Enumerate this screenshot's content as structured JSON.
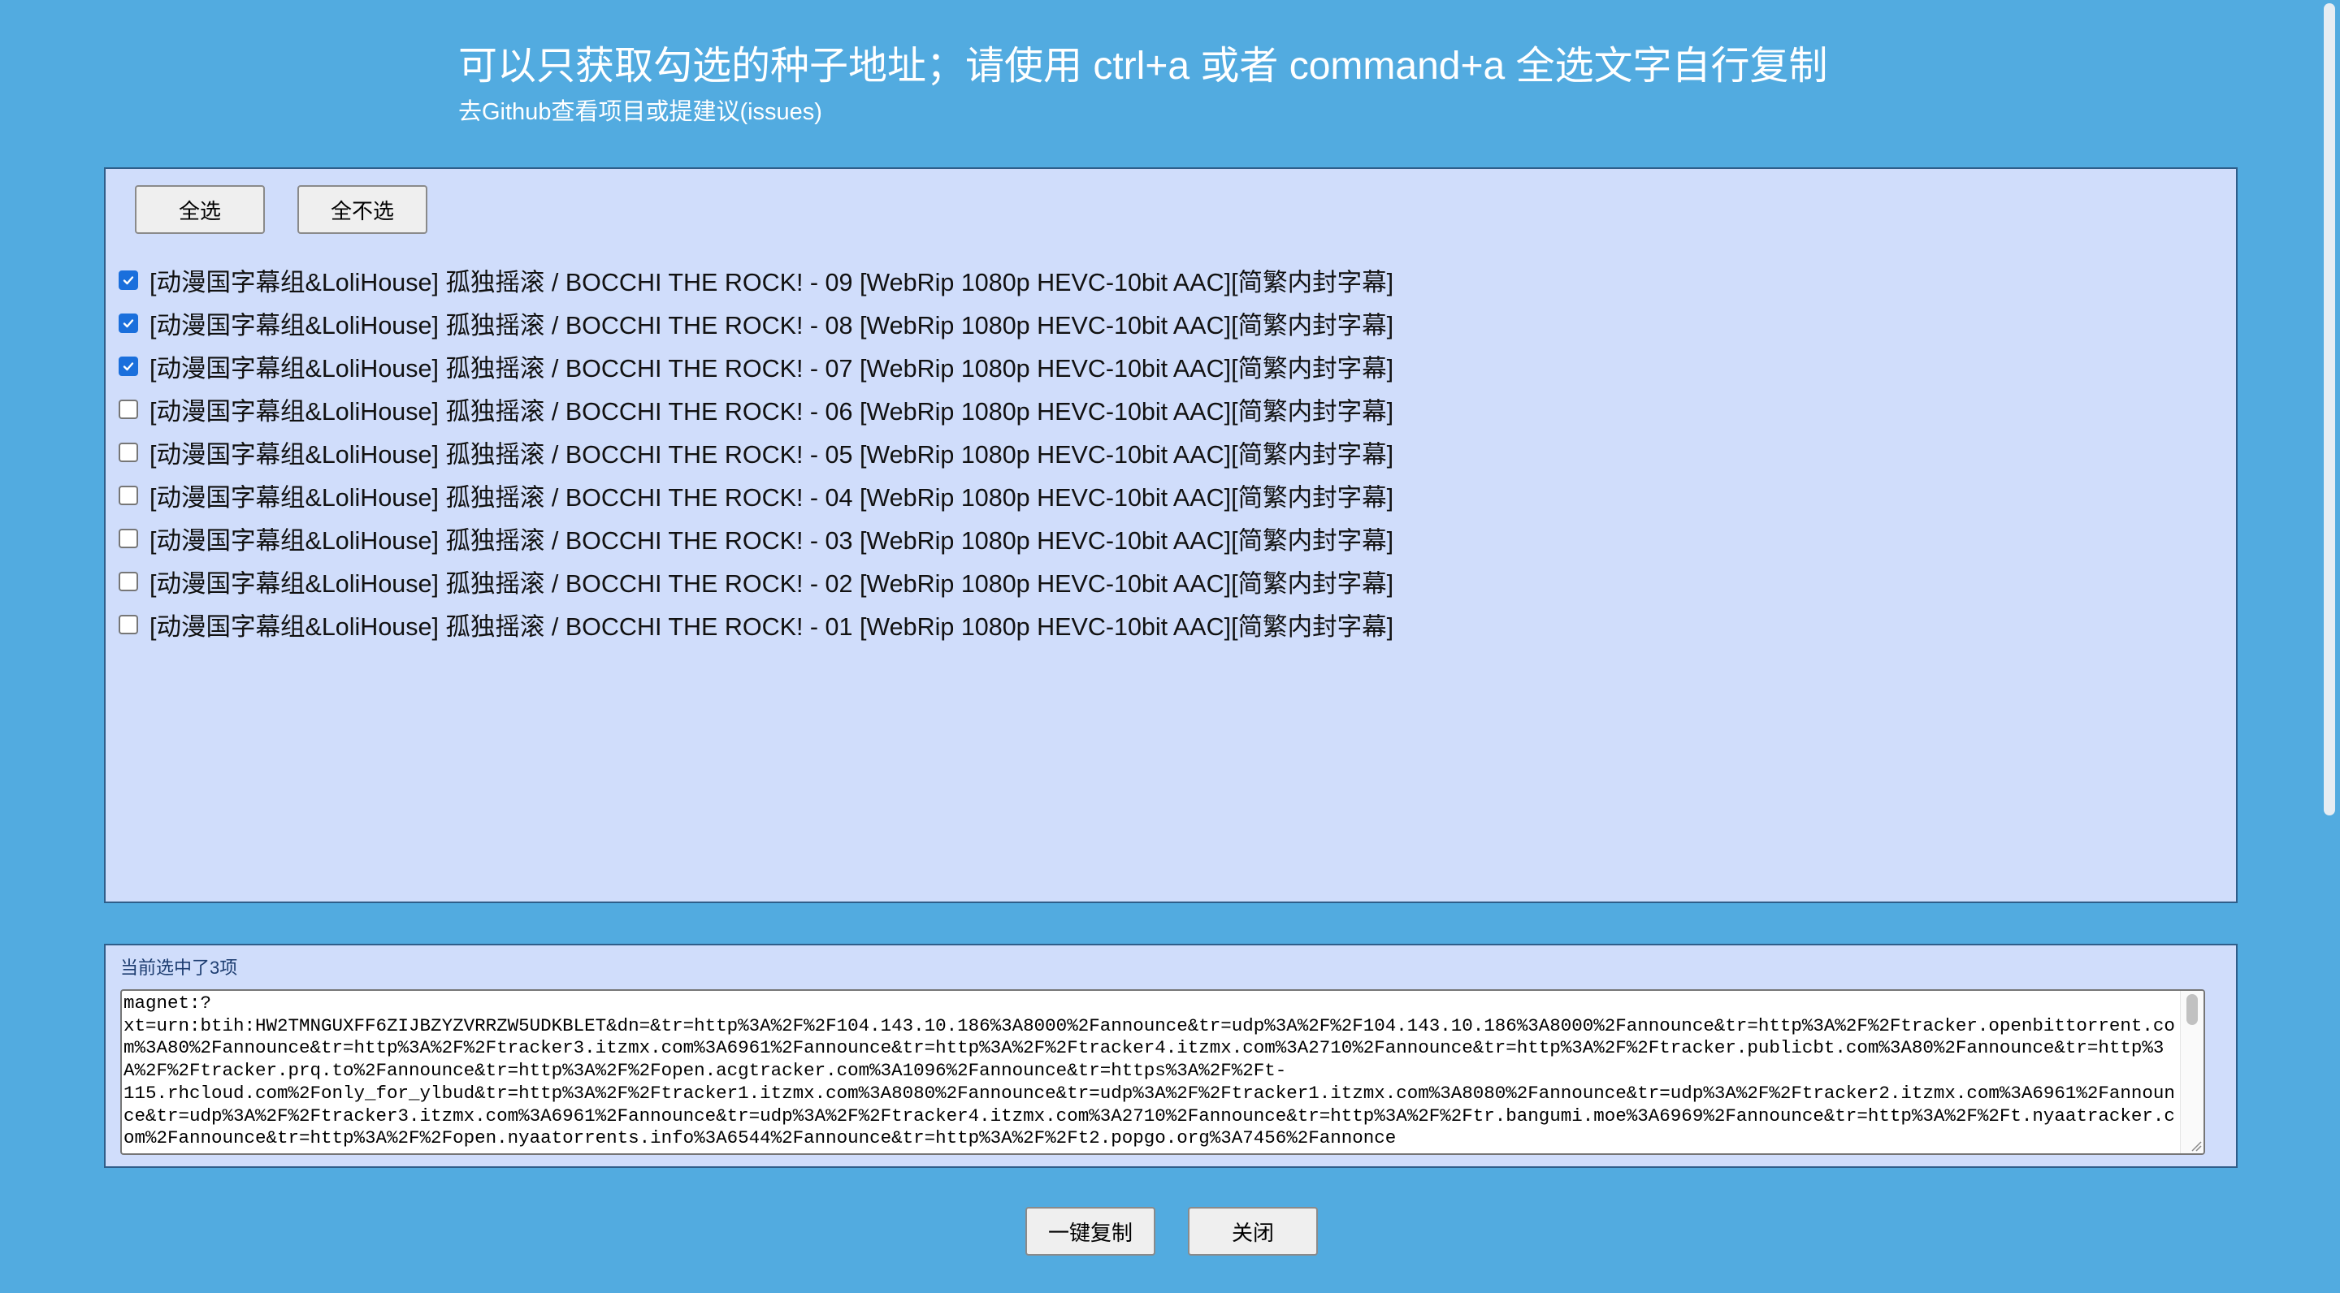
{
  "header": {
    "title": "可以只获取勾选的种子地址；请使用 ctrl+a 或者 command+a 全选文字自行复制",
    "subtitle_link": "去Github查看项目或提建议(issues)"
  },
  "toolbar": {
    "select_all_label": "全选",
    "select_none_label": "全不选"
  },
  "torrents": [
    {
      "label": "[动漫国字幕组&LoliHouse] 孤独摇滚 / BOCCHI THE ROCK! - 09 [WebRip 1080p HEVC-10bit AAC][简繁内封字幕]",
      "checked": true
    },
    {
      "label": "[动漫国字幕组&LoliHouse] 孤独摇滚 / BOCCHI THE ROCK! - 08 [WebRip 1080p HEVC-10bit AAC][简繁内封字幕]",
      "checked": true
    },
    {
      "label": "[动漫国字幕组&LoliHouse] 孤独摇滚 / BOCCHI THE ROCK! - 07 [WebRip 1080p HEVC-10bit AAC][简繁内封字幕]",
      "checked": true
    },
    {
      "label": "[动漫国字幕组&LoliHouse] 孤独摇滚 / BOCCHI THE ROCK! - 06 [WebRip 1080p HEVC-10bit AAC][简繁内封字幕]",
      "checked": false
    },
    {
      "label": "[动漫国字幕组&LoliHouse] 孤独摇滚 / BOCCHI THE ROCK! - 05 [WebRip 1080p HEVC-10bit AAC][简繁内封字幕]",
      "checked": false
    },
    {
      "label": "[动漫国字幕组&LoliHouse] 孤独摇滚 / BOCCHI THE ROCK! - 04 [WebRip 1080p HEVC-10bit AAC][简繁内封字幕]",
      "checked": false
    },
    {
      "label": "[动漫国字幕组&LoliHouse] 孤独摇滚 / BOCCHI THE ROCK! - 03 [WebRip 1080p HEVC-10bit AAC][简繁内封字幕]",
      "checked": false
    },
    {
      "label": "[动漫国字幕组&LoliHouse] 孤独摇滚 / BOCCHI THE ROCK! - 02 [WebRip 1080p HEVC-10bit AAC][简繁内封字幕]",
      "checked": false
    },
    {
      "label": "[动漫国字幕组&LoliHouse] 孤独摇滚 / BOCCHI THE ROCK! - 01 [WebRip 1080p HEVC-10bit AAC][简繁内封字幕]",
      "checked": false
    }
  ],
  "result": {
    "count_label": "当前选中了3项",
    "magnet_text": "magnet:?\nxt=urn:btih:HW2TMNGUXFF6ZIJBZYZVRRZW5UDKBLET&dn=&tr=http%3A%2F%2F104.143.10.186%3A8000%2Fannounce&tr=udp%3A%2F%2F104.143.10.186%3A8000%2Fannounce&tr=http%3A%2F%2Ftracker.openbittorrent.com%3A80%2Fannounce&tr=http%3A%2F%2Ftracker3.itzmx.com%3A6961%2Fannounce&tr=http%3A%2F%2Ftracker4.itzmx.com%3A2710%2Fannounce&tr=http%3A%2F%2Ftracker.publicbt.com%3A80%2Fannounce&tr=http%3A%2F%2Ftracker.prq.to%2Fannounce&tr=http%3A%2F%2Fopen.acgtracker.com%3A1096%2Fannounce&tr=https%3A%2F%2Ft-\n115.rhcloud.com%2Fonly_for_ylbud&tr=http%3A%2F%2Ftracker1.itzmx.com%3A8080%2Fannounce&tr=udp%3A%2F%2Ftracker1.itzmx.com%3A8080%2Fannounce&tr=udp%3A%2F%2Ftracker2.itzmx.com%3A6961%2Fannounce&tr=udp%3A%2F%2Ftracker3.itzmx.com%3A6961%2Fannounce&tr=udp%3A%2F%2Ftracker4.itzmx.com%3A2710%2Fannounce&tr=http%3A%2F%2Ftr.bangumi.moe%3A6969%2Fannounce&tr=http%3A%2F%2Ft.nyaatracker.com%2Fannounce&tr=http%3A%2F%2Fopen.nyaatorrents.info%3A6544%2Fannounce&tr=http%3A%2F%2Ft2.popgo.org%3A7456%2Fannonce"
  },
  "footer": {
    "copy_label": "一键复制",
    "close_label": "关闭"
  },
  "colors": {
    "background": "#52abe0",
    "panel": "#d0ddfb",
    "checkbox_checked": "#1a6fdc"
  }
}
